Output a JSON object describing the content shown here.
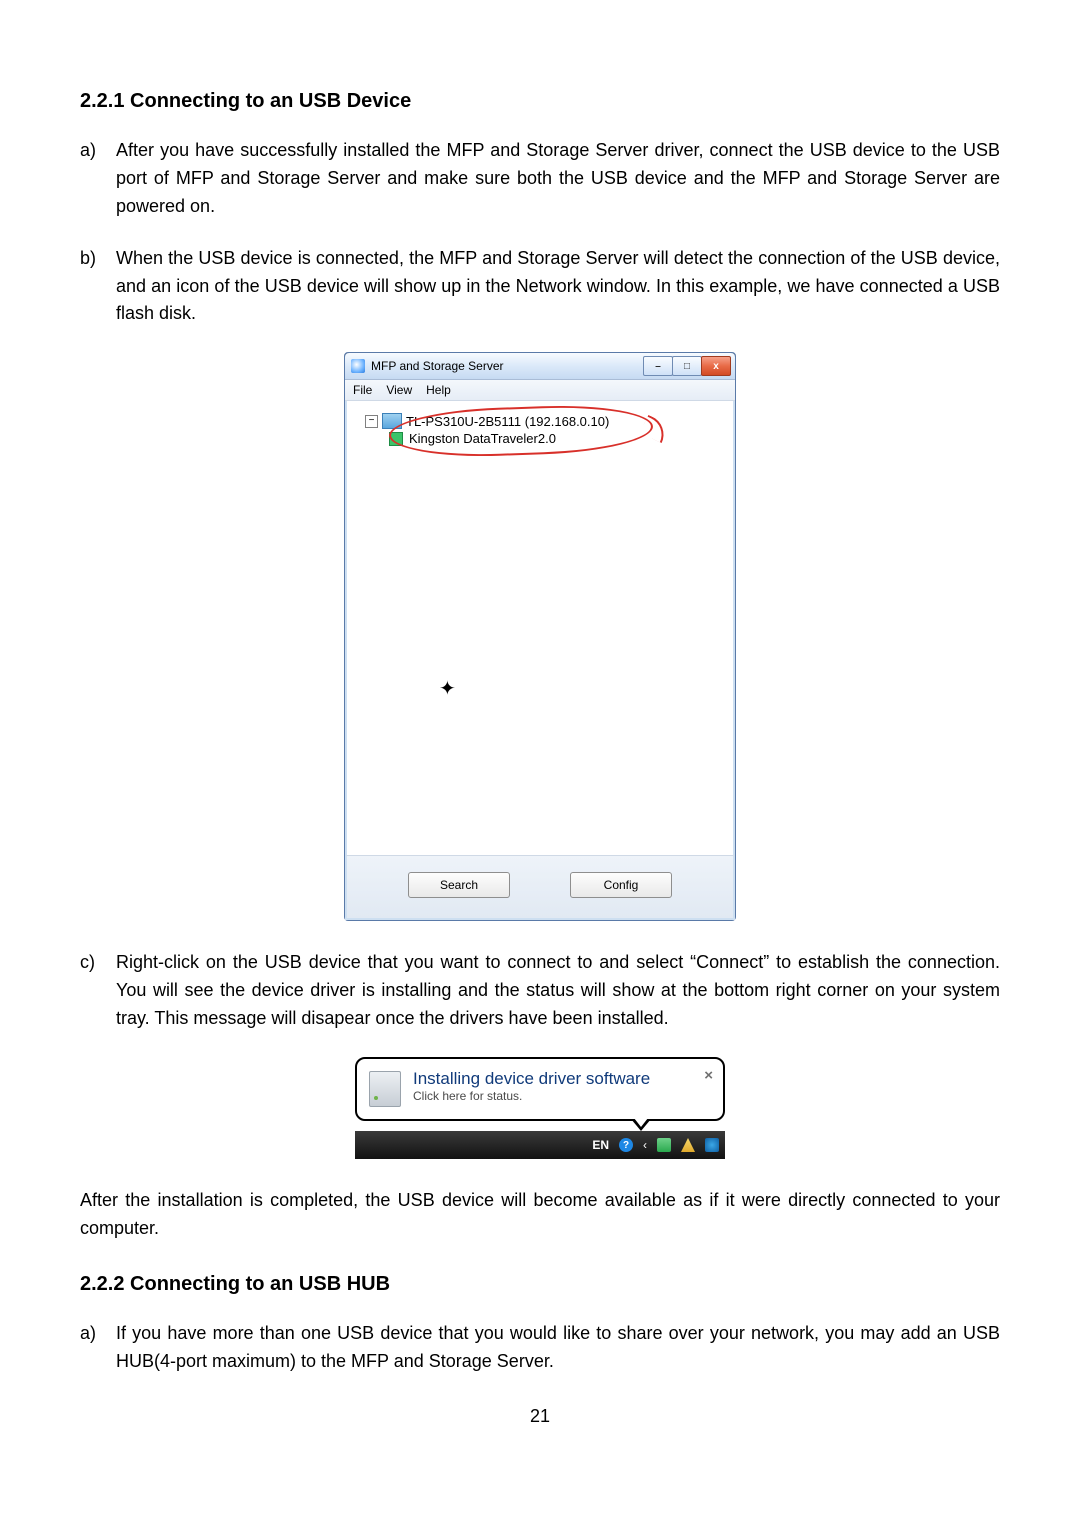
{
  "section1": {
    "heading": "2.2.1  Connecting to an USB Device",
    "items": [
      {
        "marker": "a)",
        "text": "After you have successfully installed the MFP and Storage Server driver, connect the USB device to the USB port of MFP and Storage Server and make sure both the USB device and the MFP and Storage Server are powered on."
      },
      {
        "marker": "b)",
        "text": "When the USB device is connected, the MFP and Storage Server will detect the connection of the USB device, and an icon of the USB device will show up in the Network window. In this example, we have connected a USB flash disk."
      },
      {
        "marker": "c)",
        "text": "Right-click on the USB device that you want to connect to and select “Connect” to establish the connection. You will see the device driver is installing and the status will show at the bottom right corner on your system tray. This message will disapear once the drivers have been installed."
      }
    ]
  },
  "window": {
    "title": "MFP and Storage Server",
    "menus": [
      "File",
      "View",
      "Help"
    ],
    "tree": {
      "server": "TL-PS310U-2B5111 (192.168.0.10)",
      "device": "Kingston DataTraveler2.0"
    },
    "buttons": {
      "search": "Search",
      "config": "Config"
    },
    "controls": {
      "min": "–",
      "max": "□",
      "close": "x"
    },
    "expander": "−"
  },
  "balloon": {
    "title": "Installing device driver software",
    "sub": "Click here for status.",
    "close": "×"
  },
  "tray": {
    "lang": "EN",
    "help": "?",
    "chev": "‹"
  },
  "after_text": "After the installation is completed, the USB device will become available as if it were directly connected to your computer.",
  "section2": {
    "heading": "2.2.2  Connecting to an USB HUB",
    "items": [
      {
        "marker": "a)",
        "text": "If you have more than one USB device that you would like to share over your network, you may add an USB HUB(4-port maximum) to the MFP and Storage Server."
      }
    ]
  },
  "page_number": "21"
}
